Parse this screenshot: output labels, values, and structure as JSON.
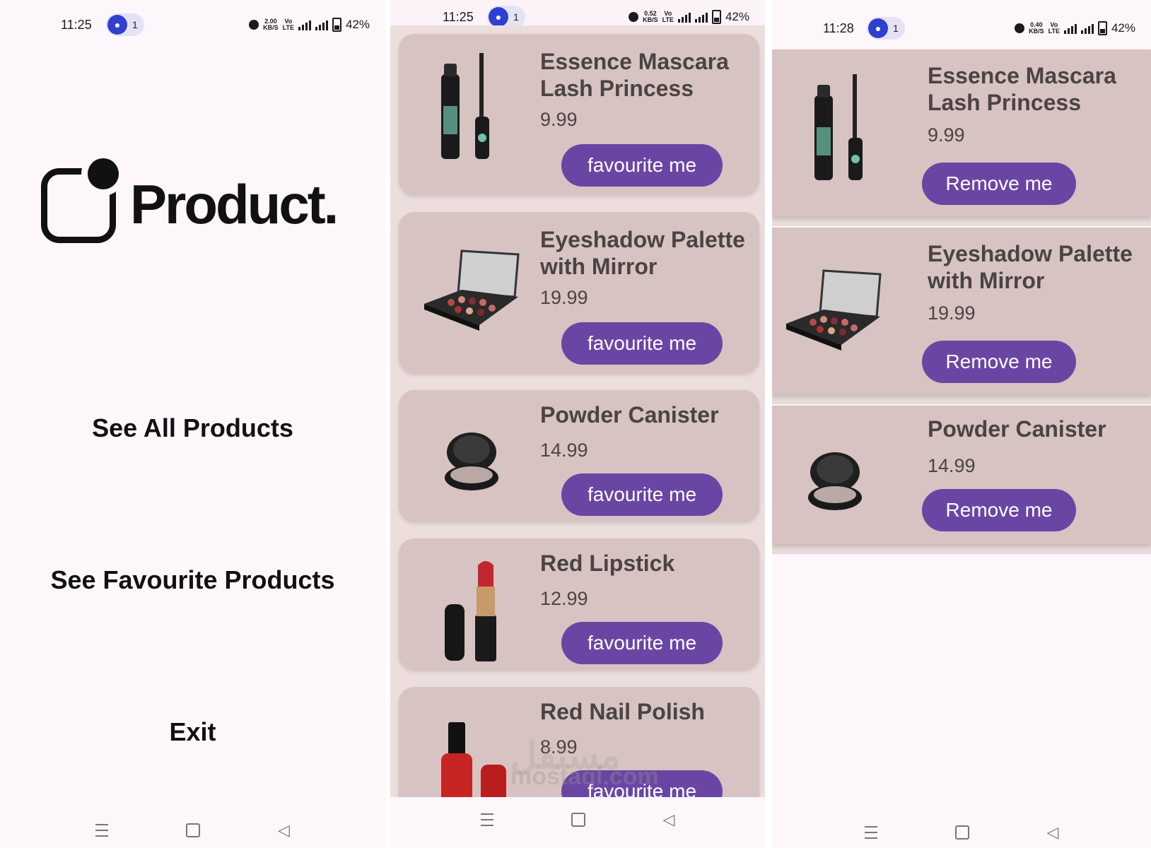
{
  "screens": {
    "home": {
      "status": {
        "time": "11:25",
        "hotspot_count": "1",
        "speed": "2.00",
        "speed_unit": "KB/S",
        "battery": "42%"
      },
      "logo_text": "Product.",
      "menu": [
        "See All Products",
        "See Favourite Products",
        "Exit"
      ]
    },
    "all_products": {
      "status": {
        "time": "11:25",
        "hotspot_count": "1",
        "speed": "0.52",
        "speed_unit": "KB/S",
        "battery": "42%"
      },
      "products": [
        {
          "name": "Essence Mascara Lash Princess",
          "price": "9.99",
          "button": "favourite me",
          "icon": "mascara-icon"
        },
        {
          "name": "Eyeshadow Palette with Mirror",
          "price": "19.99",
          "button": "favourite me",
          "icon": "eyeshadow-palette-icon"
        },
        {
          "name": "Powder Canister",
          "price": "14.99",
          "button": "favourite me",
          "icon": "powder-compact-icon"
        },
        {
          "name": "Red Lipstick",
          "price": "12.99",
          "button": "favourite me",
          "icon": "lipstick-icon"
        },
        {
          "name": "Red Nail Polish",
          "price": "8.99",
          "button": "favourite me",
          "icon": "nail-polish-icon"
        }
      ]
    },
    "favourites": {
      "status": {
        "time": "11:28",
        "hotspot_count": "1",
        "speed": "0.40",
        "speed_unit": "KB/S",
        "battery": "42%"
      },
      "products": [
        {
          "name": "Essence Mascara Lash Princess",
          "price": "9.99",
          "button": "Remove me",
          "icon": "mascara-icon"
        },
        {
          "name": "Eyeshadow Palette with Mirror",
          "price": "19.99",
          "button": "Remove me",
          "icon": "eyeshadow-palette-icon"
        },
        {
          "name": "Powder Canister",
          "price": "14.99",
          "button": "Remove me",
          "icon": "powder-compact-icon"
        }
      ]
    }
  },
  "watermark": {
    "arabic": "مستقل",
    "latin": "mostaql.com"
  },
  "colors": {
    "accent": "#6a46a4",
    "card": "#d7c3c1",
    "text": "#4a4444"
  }
}
